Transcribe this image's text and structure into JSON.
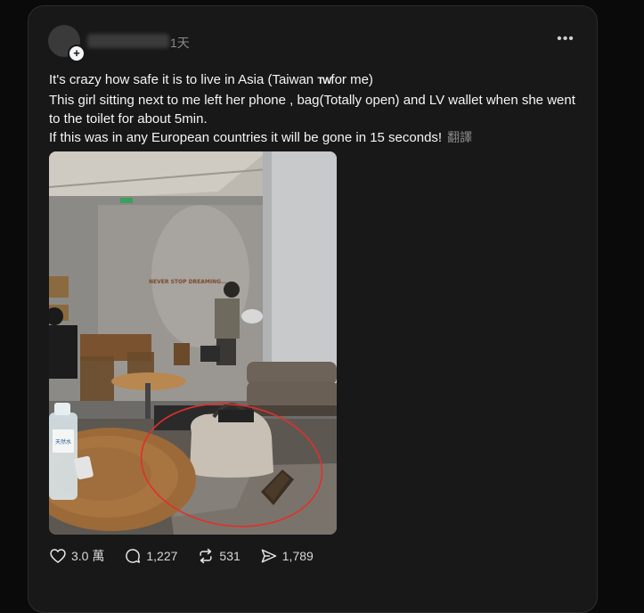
{
  "post": {
    "timestamp": "1天",
    "text_lines": [
      "It's crazy how safe it is to live in Asia (Taiwan ",
      "for me)",
      "This girl sitting next to me left her phone , bag(Totally open) and LV wallet when she went to the toilet for about 5min.",
      "If this was in any European countries it will be gone in 15 seconds!"
    ],
    "flag_text": "TW",
    "translate_label": "翻譯",
    "photo_wall_text": "NEVER STOP DREAMING...",
    "water_label": "天然水"
  },
  "actions": {
    "likes": "3.0 萬",
    "comments": "1,227",
    "reposts": "531",
    "shares": "1,789"
  },
  "colors": {
    "background": "#0a0a0a",
    "card": "#181818",
    "text": "#f3f5f7",
    "muted": "#8a8a8a",
    "circle_annotation": "#e0302a"
  }
}
